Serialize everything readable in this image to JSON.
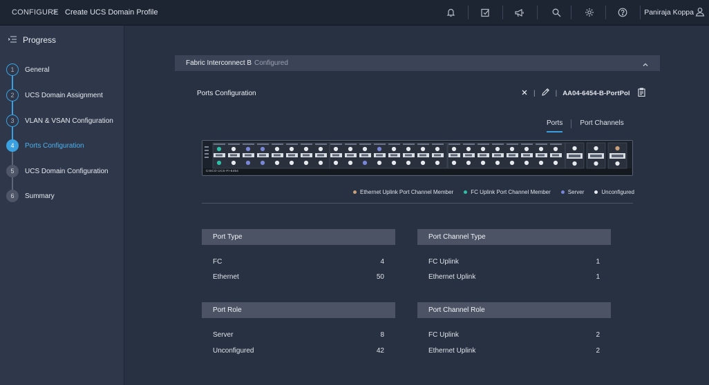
{
  "breadcrumb": {
    "root": "CONFIGURE",
    "separator": ">",
    "page": "Create UCS Domain Profile"
  },
  "user": {
    "name": "Paniraja Koppa"
  },
  "sidebar": {
    "title": "Progress",
    "steps": [
      {
        "num": "1",
        "label": "General",
        "state": "done"
      },
      {
        "num": "2",
        "label": "UCS Domain Assignment",
        "state": "done"
      },
      {
        "num": "3",
        "label": "VLAN & VSAN Configuration",
        "state": "done"
      },
      {
        "num": "4",
        "label": "Ports Configuration",
        "state": "current"
      },
      {
        "num": "5",
        "label": "UCS Domain Configuration",
        "state": "todo"
      },
      {
        "num": "6",
        "label": "Summary",
        "state": "todo"
      }
    ]
  },
  "fabric": {
    "title": "Fabric Interconnect B",
    "status": "Configured"
  },
  "ports_config": {
    "title": "Ports Configuration",
    "policy_name": "AA04-6454-B-PortPol",
    "tabs": [
      "Ports",
      "Port Channels"
    ],
    "switch_model": "CISCO UCS-FI-6454"
  },
  "legend": [
    {
      "label": "Ethernet Uplink Port Channel Member",
      "color": "#c8a07a"
    },
    {
      "label": "FC Uplink Port Channel Member",
      "color": "#2fbfa8"
    },
    {
      "label": "Server",
      "color": "#7a86d8"
    },
    {
      "label": "Unconfigured",
      "color": "#e6e9ee"
    }
  ],
  "cards": {
    "port_type": {
      "title": "Port Type",
      "rows": [
        {
          "label": "FC",
          "value": "4"
        },
        {
          "label": "Ethernet",
          "value": "50"
        }
      ]
    },
    "port_channel_type": {
      "title": "Port Channel Type",
      "rows": [
        {
          "label": "FC Uplink",
          "value": "1"
        },
        {
          "label": "Ethernet Uplink",
          "value": "1"
        }
      ]
    },
    "port_role": {
      "title": "Port Role",
      "rows": [
        {
          "label": "Server",
          "value": "8"
        },
        {
          "label": "Unconfigured",
          "value": "42"
        }
      ]
    },
    "port_channel_role": {
      "title": "Port Channel Role",
      "rows": [
        {
          "label": "FC Uplink",
          "value": "2"
        },
        {
          "label": "Ethernet Uplink",
          "value": "2"
        }
      ]
    }
  },
  "icons": {
    "topbar": [
      "bell-icon",
      "tasks-icon",
      "announcement-icon",
      "search-icon",
      "settings-icon",
      "help-icon"
    ],
    "sidebar": "progress-list-icon"
  }
}
